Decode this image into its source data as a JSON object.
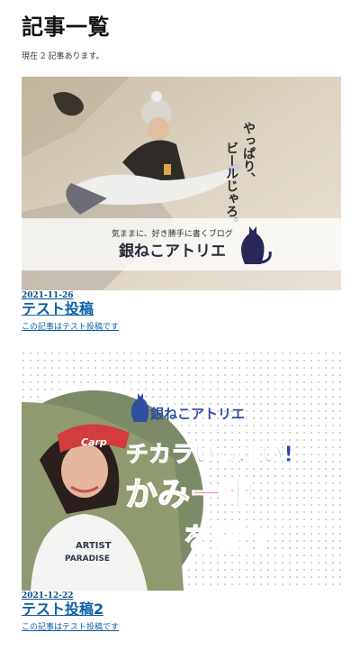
{
  "page": {
    "title": "記事一覧",
    "summary": "現在 2 記事あります。"
  },
  "posts": [
    {
      "date": "2021-11-26",
      "title": "テスト投稿",
      "excerpt": "この記事はテスト投稿です",
      "thumb": {
        "tagline_1": "やっぱり、",
        "tagline_2": "ビールじゃろ。",
        "blog_caption": "気ままに、好き勝手に書くブログ",
        "blog_name": "銀ねこアトリエ"
      }
    },
    {
      "date": "2021-12-22",
      "title": "テスト投稿2",
      "excerpt": "この記事はテスト投稿です",
      "thumb": {
        "logo": "銀ねこアトリエ",
        "headline_1": "チカラいっぱい!",
        "headline_2": "かみー中",
        "headline_3": "を紹介",
        "cap_text": "Carp",
        "shirt_text_1": "ARTIST",
        "shirt_text_2": "PARADISE"
      }
    }
  ]
}
